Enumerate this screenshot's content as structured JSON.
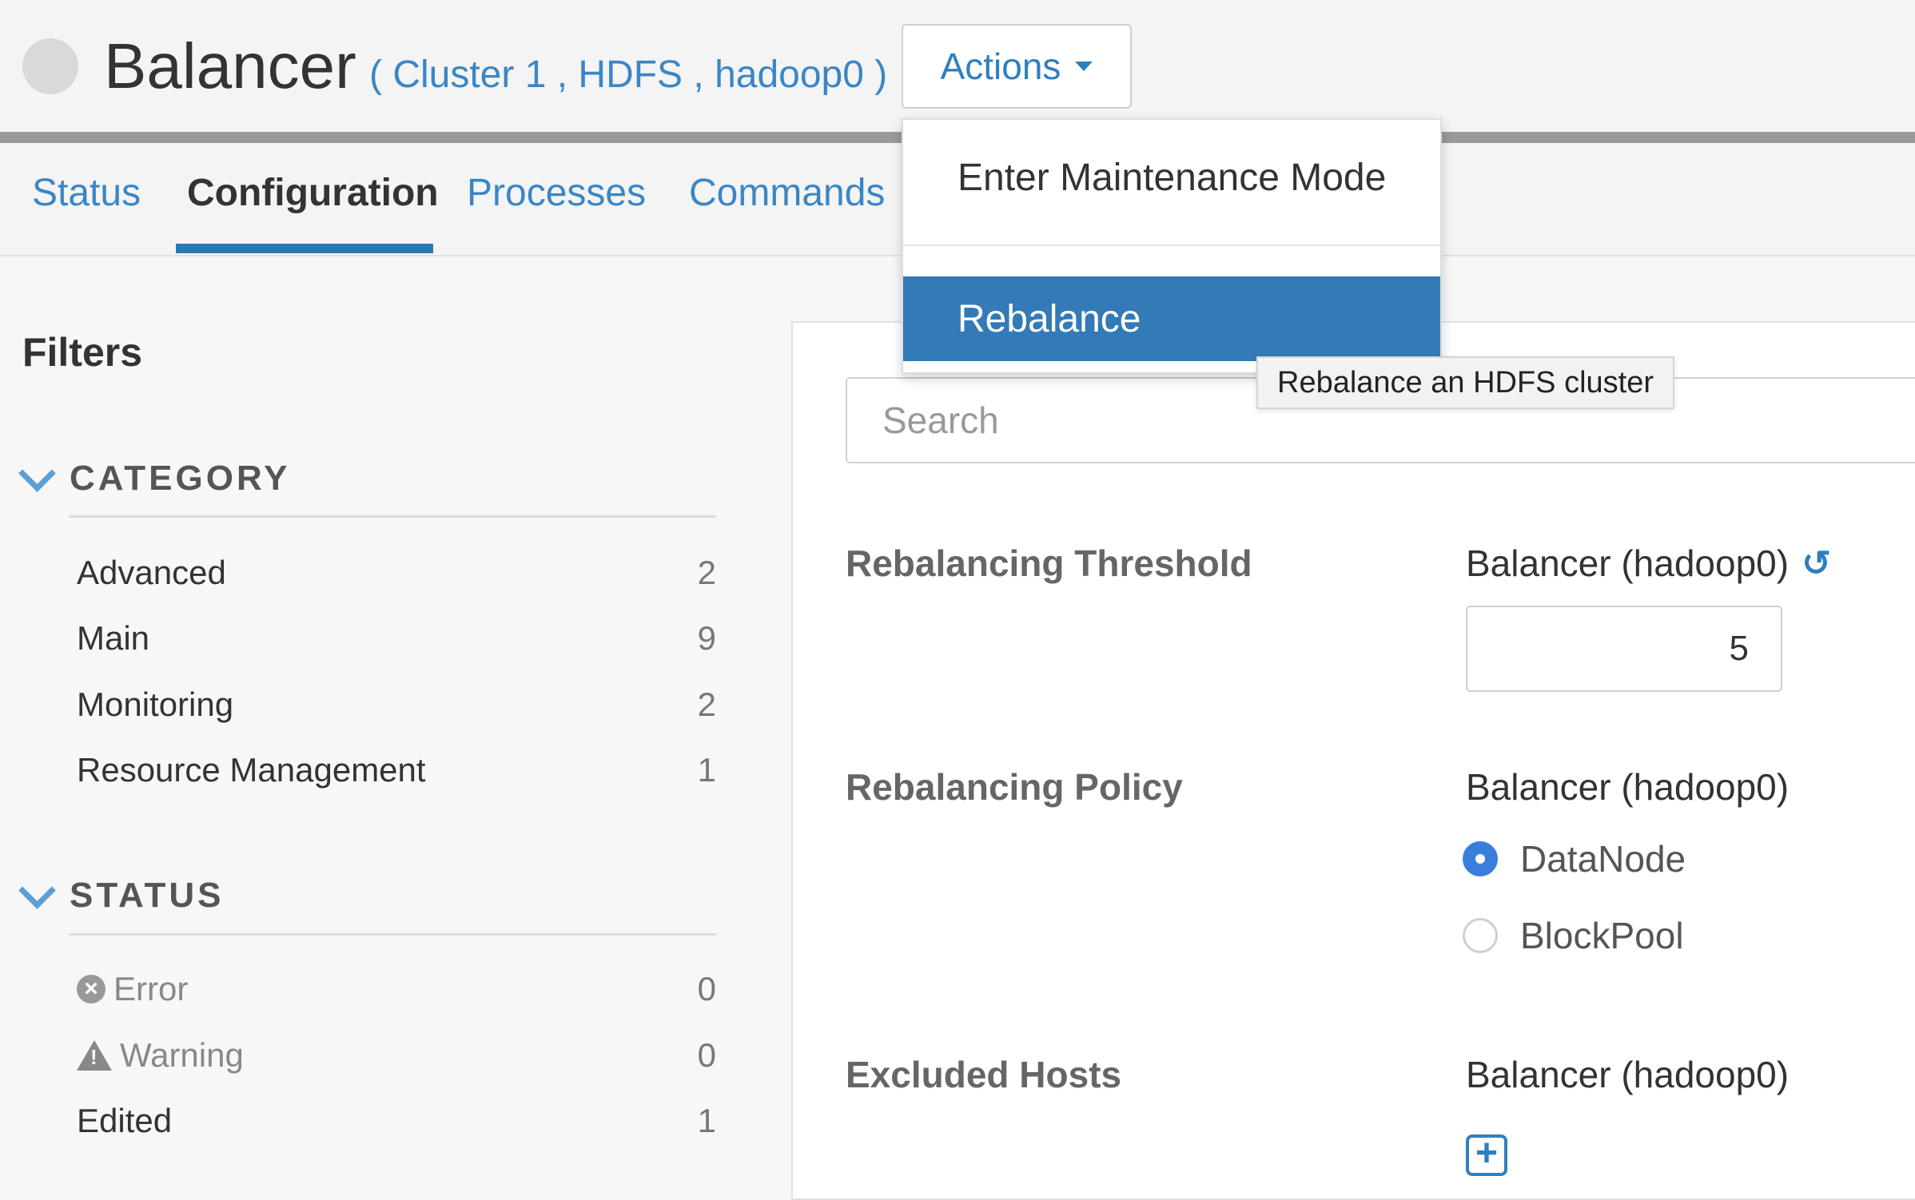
{
  "header": {
    "title": "Balancer",
    "breadcrumb": "( Cluster 1 , HDFS , hadoop0 )",
    "actions_label": "Actions"
  },
  "tabs": [
    {
      "label": "Status",
      "active": false
    },
    {
      "label": "Configuration",
      "active": true
    },
    {
      "label": "Processes",
      "active": false
    },
    {
      "label": "Commands",
      "active": false
    }
  ],
  "actions_menu": {
    "items": [
      {
        "label": "Enter Maintenance Mode"
      },
      {
        "label": "Rebalance",
        "highlighted": true
      }
    ],
    "tooltip": "Rebalance an HDFS cluster"
  },
  "sidebar": {
    "title": "Filters",
    "category": {
      "heading": "CATEGORY",
      "items": [
        {
          "label": "Advanced",
          "count": "2"
        },
        {
          "label": "Main",
          "count": "9"
        },
        {
          "label": "Monitoring",
          "count": "2"
        },
        {
          "label": "Resource Management",
          "count": "1"
        }
      ]
    },
    "status": {
      "heading": "STATUS",
      "items": [
        {
          "label": "Error",
          "count": "0",
          "icon": "error-icon"
        },
        {
          "label": "Warning",
          "count": "0",
          "icon": "warning-icon"
        },
        {
          "label": "Edited",
          "count": "1"
        }
      ]
    }
  },
  "main": {
    "search_placeholder": "Search",
    "properties": [
      {
        "label": "Rebalancing Threshold",
        "scope": "Balancer (hadoop0)",
        "value": "5"
      },
      {
        "label": "Rebalancing Policy",
        "scope": "Balancer (hadoop0)",
        "options": [
          "DataNode",
          "BlockPool"
        ],
        "selected": "DataNode"
      },
      {
        "label": "Excluded Hosts",
        "scope": "Balancer (hadoop0)"
      }
    ]
  },
  "colors": {
    "accent": "#337ab7",
    "link": "#3b86c5",
    "radio_selected": "#3b7ddd"
  }
}
